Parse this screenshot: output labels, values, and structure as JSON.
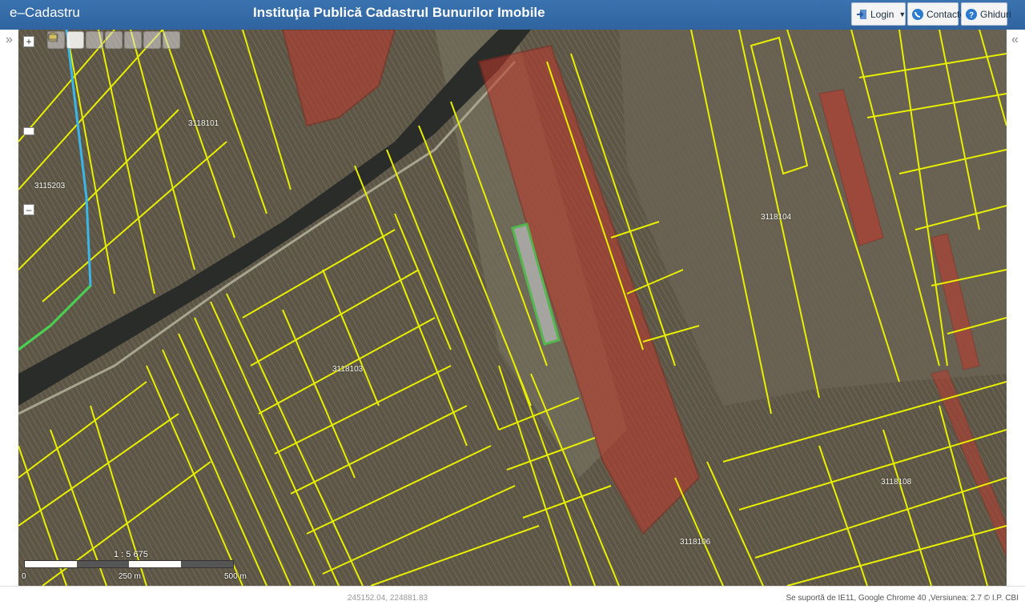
{
  "header": {
    "app_title": "e–Cadastru",
    "org_title": "Instituţia Publică Cadastrul Bunurilor Imobile",
    "login_label": "Login",
    "contacte_label": "Contacte",
    "ghiduri_label": "Ghiduri"
  },
  "rails": {
    "left_arrow": "»",
    "right_arrow": "«"
  },
  "zoom": {
    "plus": "+",
    "minus": "–"
  },
  "map": {
    "parcel_labels": [
      "3118101",
      "3115203",
      "3118103",
      "3118104",
      "3118106",
      "3118108"
    ],
    "colors": {
      "boundary": "#e8f000",
      "highlight": "#c0392b",
      "selected": "#4cd04c",
      "river": "#3bb6e8"
    }
  },
  "scale": {
    "ratio": "1 : 5 675",
    "tick0": "0",
    "tick1": "250 m",
    "tick2": "500 m"
  },
  "footer": {
    "coordinates": "245152.04, 224881.83",
    "support_text": "Se suportă de IE11, Google Chrome 40 ,Versiunea: 2.7 © I.P. CBI"
  }
}
